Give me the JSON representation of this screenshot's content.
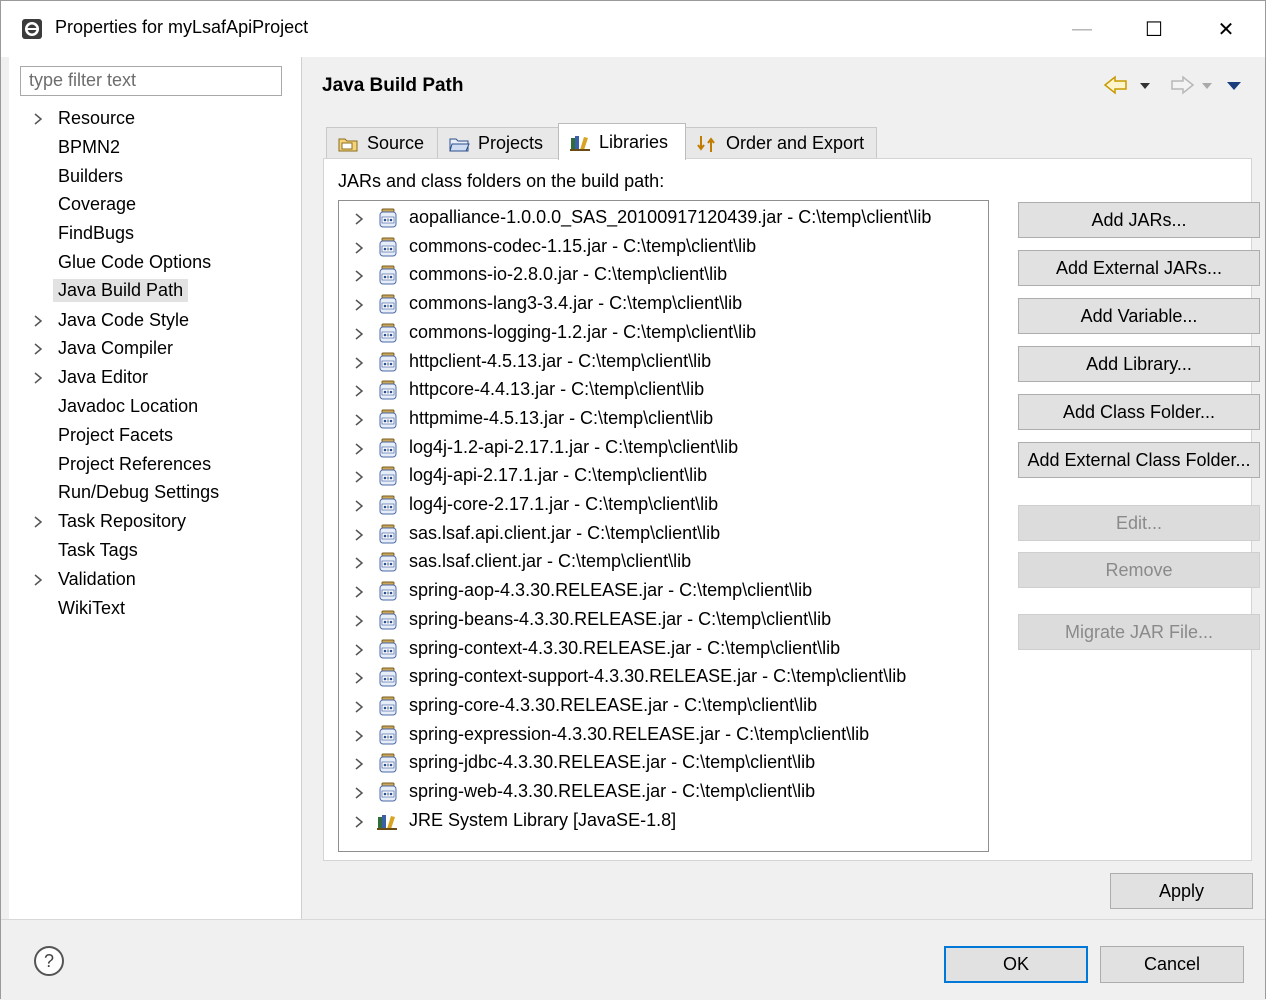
{
  "window": {
    "title": "Properties for myLsafApiProject",
    "minimize": "—",
    "maximize": "☐",
    "close": "✕"
  },
  "sidebar": {
    "filter_placeholder": "type filter text",
    "items": [
      {
        "label": "Resource",
        "expandable": true
      },
      {
        "label": "BPMN2",
        "expandable": false
      },
      {
        "label": "Builders",
        "expandable": false
      },
      {
        "label": "Coverage",
        "expandable": false
      },
      {
        "label": "FindBugs",
        "expandable": false
      },
      {
        "label": "Glue Code Options",
        "expandable": false
      },
      {
        "label": "Java Build Path",
        "expandable": false,
        "selected": true
      },
      {
        "label": "Java Code Style",
        "expandable": true
      },
      {
        "label": "Java Compiler",
        "expandable": true
      },
      {
        "label": "Java Editor",
        "expandable": true
      },
      {
        "label": "Javadoc Location",
        "expandable": false
      },
      {
        "label": "Project Facets",
        "expandable": false
      },
      {
        "label": "Project References",
        "expandable": false
      },
      {
        "label": "Run/Debug Settings",
        "expandable": false
      },
      {
        "label": "Task Repository",
        "expandable": true
      },
      {
        "label": "Task Tags",
        "expandable": false
      },
      {
        "label": "Validation",
        "expandable": true
      },
      {
        "label": "WikiText",
        "expandable": false
      }
    ]
  },
  "main": {
    "title": "Java Build Path",
    "tabs": [
      {
        "label": "Source",
        "icon": "source-folder-icon"
      },
      {
        "label": "Projects",
        "icon": "projects-folder-icon"
      },
      {
        "label": "Libraries",
        "icon": "libraries-icon",
        "active": true
      },
      {
        "label": "Order and Export",
        "icon": "order-export-icon"
      }
    ],
    "list_label": "JARs and class folders on the build path:",
    "entries": [
      "aopalliance-1.0.0.0_SAS_20100917120439.jar - C:\\temp\\client\\lib",
      "commons-codec-1.15.jar - C:\\temp\\client\\lib",
      "commons-io-2.8.0.jar - C:\\temp\\client\\lib",
      "commons-lang3-3.4.jar - C:\\temp\\client\\lib",
      "commons-logging-1.2.jar - C:\\temp\\client\\lib",
      "httpclient-4.5.13.jar - C:\\temp\\client\\lib",
      "httpcore-4.4.13.jar - C:\\temp\\client\\lib",
      "httpmime-4.5.13.jar - C:\\temp\\client\\lib",
      "log4j-1.2-api-2.17.1.jar - C:\\temp\\client\\lib",
      "log4j-api-2.17.1.jar - C:\\temp\\client\\lib",
      "log4j-core-2.17.1.jar - C:\\temp\\client\\lib",
      "sas.lsaf.api.client.jar - C:\\temp\\client\\lib",
      "sas.lsaf.client.jar - C:\\temp\\client\\lib",
      "spring-aop-4.3.30.RELEASE.jar - C:\\temp\\client\\lib",
      "spring-beans-4.3.30.RELEASE.jar - C:\\temp\\client\\lib",
      "spring-context-4.3.30.RELEASE.jar - C:\\temp\\client\\lib",
      "spring-context-support-4.3.30.RELEASE.jar - C:\\temp\\client\\lib",
      "spring-core-4.3.30.RELEASE.jar - C:\\temp\\client\\lib",
      "spring-expression-4.3.30.RELEASE.jar - C:\\temp\\client\\lib",
      "spring-jdbc-4.3.30.RELEASE.jar - C:\\temp\\client\\lib",
      "spring-web-4.3.30.RELEASE.jar - C:\\temp\\client\\lib"
    ],
    "jre_entry": "JRE System Library [JavaSE-1.8]",
    "buttons": [
      {
        "label": "Add JARs...",
        "enabled": true
      },
      {
        "label": "Add External JARs...",
        "enabled": true
      },
      {
        "label": "Add Variable...",
        "enabled": true
      },
      {
        "label": "Add Library...",
        "enabled": true
      },
      {
        "label": "Add Class Folder...",
        "enabled": true
      },
      {
        "label": "Add External Class Folder...",
        "enabled": true
      },
      {
        "label": "Edit...",
        "enabled": false
      },
      {
        "label": "Remove",
        "enabled": false
      },
      {
        "label": "Migrate JAR File...",
        "enabled": false
      }
    ],
    "apply_label": "Apply"
  },
  "footer": {
    "help_icon": "?",
    "ok_label": "OK",
    "cancel_label": "Cancel"
  },
  "colors": {
    "accent": "#0078d7",
    "selection": "#e2e2e2"
  }
}
